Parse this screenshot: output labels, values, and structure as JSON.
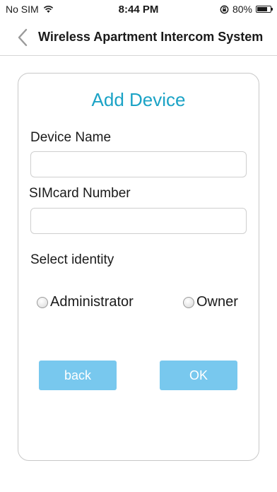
{
  "status_bar": {
    "carrier": "No SIM",
    "time": "8:44 PM",
    "battery_percent": "80%",
    "battery_level": 0.8,
    "icons": [
      "wifi-icon",
      "orientation-lock-icon",
      "battery-icon"
    ]
  },
  "nav": {
    "title": "Wireless Apartment Intercom System",
    "back_icon": "chevron-left-icon"
  },
  "form": {
    "title": "Add Device",
    "device_name_label": "Device Name",
    "device_name_value": "",
    "sim_label": "SIMcard Number",
    "sim_value": "",
    "identity_label": "Select identity",
    "options": [
      {
        "label": "Administrator",
        "selected": false
      },
      {
        "label": "Owner",
        "selected": false
      }
    ],
    "back_label": "back",
    "ok_label": "OK"
  },
  "colors": {
    "accent": "#1ba3c6",
    "button": "#78c8ee"
  }
}
